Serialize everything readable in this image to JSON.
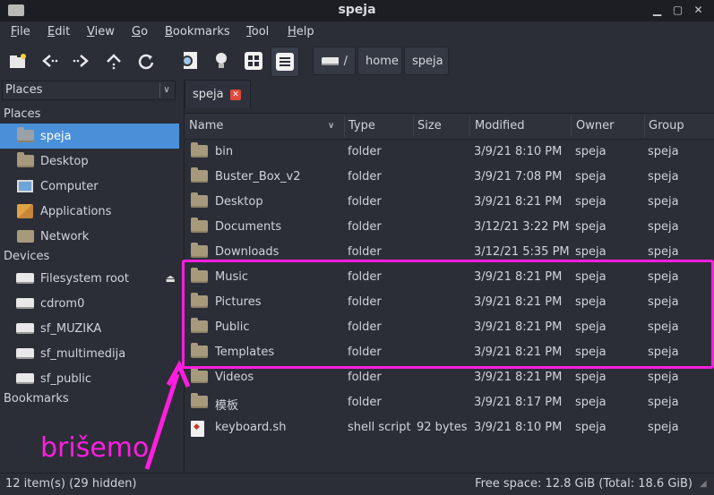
{
  "window": {
    "title": "speja"
  },
  "menubar": [
    {
      "label": "File",
      "u": "F",
      "rest": "ile"
    },
    {
      "label": "Edit",
      "u": "E",
      "rest": "dit"
    },
    {
      "label": "View",
      "u": "V",
      "rest": "iew"
    },
    {
      "label": "Go",
      "u": "G",
      "rest": "o"
    },
    {
      "label": "Bookmarks",
      "u": "B",
      "rest": "ookmarks"
    },
    {
      "label": "Tool",
      "u": "T",
      "rest": "ool"
    },
    {
      "label": "Help",
      "u": "H",
      "rest": "elp"
    }
  ],
  "path": {
    "root": "/",
    "parts": [
      "home",
      "speja"
    ]
  },
  "sidebar": {
    "combo": "Places",
    "places_title": "Places",
    "places": [
      "speja",
      "Desktop",
      "Computer",
      "Applications",
      "Network"
    ],
    "devices_title": "Devices",
    "devices": [
      "Filesystem root",
      "cdrom0",
      "sf_MUZIKA",
      "sf_multimedija",
      "sf_public"
    ],
    "bookmarks_title": "Bookmarks"
  },
  "tab": {
    "label": "speja"
  },
  "columns": [
    "Name",
    "Type",
    "Size",
    "Modified",
    "Owner",
    "Group"
  ],
  "files": [
    {
      "name": "bin",
      "type": "folder",
      "size": "",
      "modified": "3/9/21 8:10 PM",
      "owner": "speja",
      "group": "speja"
    },
    {
      "name": "Buster_Box_v2",
      "type": "folder",
      "size": "",
      "modified": "3/9/21 7:08 PM",
      "owner": "speja",
      "group": "speja"
    },
    {
      "name": "Desktop",
      "type": "folder",
      "size": "",
      "modified": "3/9/21 8:21 PM",
      "owner": "speja",
      "group": "speja"
    },
    {
      "name": "Documents",
      "type": "folder",
      "size": "",
      "modified": "3/12/21 3:22 PM",
      "owner": "speja",
      "group": "speja"
    },
    {
      "name": "Downloads",
      "type": "folder",
      "size": "",
      "modified": "3/12/21 5:35 PM",
      "owner": "speja",
      "group": "speja"
    },
    {
      "name": "Music",
      "type": "folder",
      "size": "",
      "modified": "3/9/21 8:21 PM",
      "owner": "speja",
      "group": "speja"
    },
    {
      "name": "Pictures",
      "type": "folder",
      "size": "",
      "modified": "3/9/21 8:21 PM",
      "owner": "speja",
      "group": "speja"
    },
    {
      "name": "Public",
      "type": "folder",
      "size": "",
      "modified": "3/9/21 8:21 PM",
      "owner": "speja",
      "group": "speja"
    },
    {
      "name": "Templates",
      "type": "folder",
      "size": "",
      "modified": "3/9/21 8:21 PM",
      "owner": "speja",
      "group": "speja"
    },
    {
      "name": "Videos",
      "type": "folder",
      "size": "",
      "modified": "3/9/21 8:21 PM",
      "owner": "speja",
      "group": "speja"
    },
    {
      "name": "模板",
      "type": "folder",
      "size": "",
      "modified": "3/9/21 8:17 PM",
      "owner": "speja",
      "group": "speja"
    },
    {
      "name": "keyboard.sh",
      "type": "shell script",
      "size": "92 bytes",
      "modified": "3/9/21 8:10 PM",
      "owner": "speja",
      "group": "speja"
    }
  ],
  "status": {
    "items": "12 item(s) (29 hidden)",
    "free": "Free space: 12.8 GiB (Total: 18.6 GiB)"
  },
  "annotation": {
    "text": "brišemo",
    "color": "#ff1ee0"
  }
}
